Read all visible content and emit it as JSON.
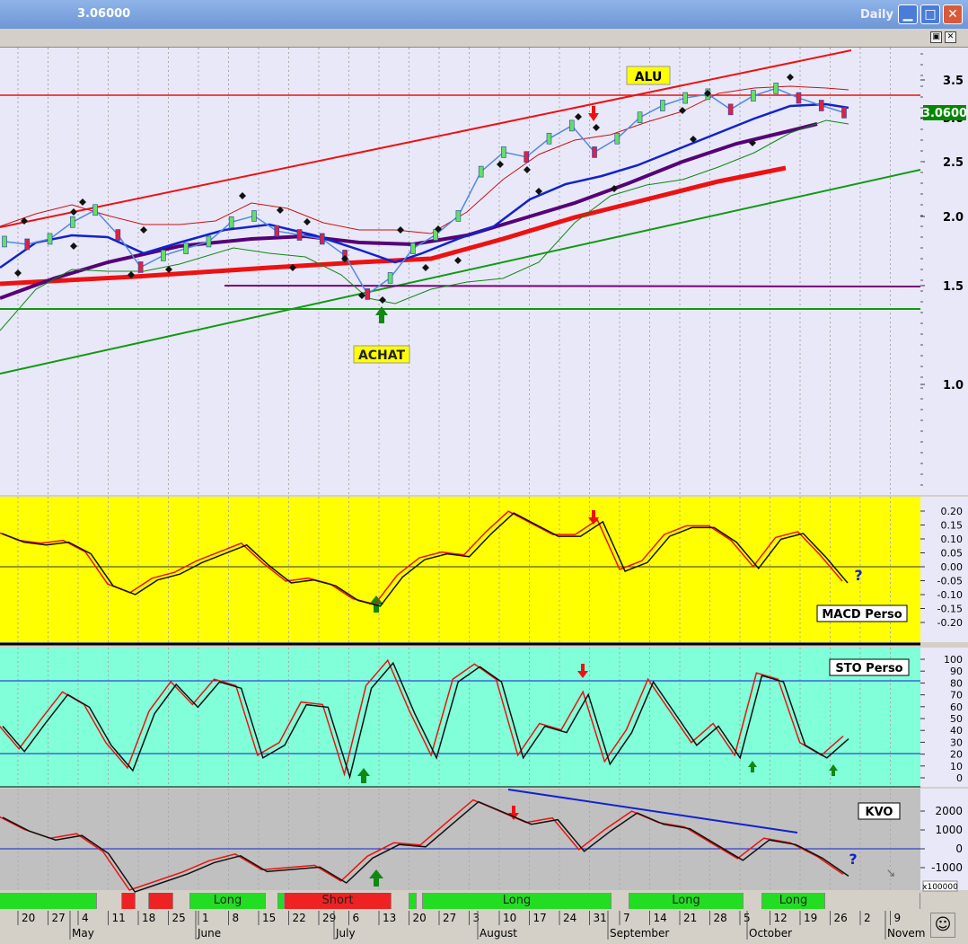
{
  "window": {
    "title": "3.06000",
    "period": "Daily"
  },
  "price_panel": {
    "last_price": "3.0600",
    "labels": {
      "top": "ALU",
      "bottom": "ACHAT"
    },
    "yticks": [
      "3.5",
      "3.0",
      "2.5",
      "2.0",
      "1.5",
      "1.0"
    ]
  },
  "macd_panel": {
    "name": "MACD Perso",
    "yticks": [
      "0.20",
      "0.15",
      "0.10",
      "0.05",
      "0.00",
      "-0.05",
      "-0.10",
      "-0.15",
      "-0.20"
    ],
    "question": "?"
  },
  "sto_panel": {
    "name": "STO Perso",
    "yticks": [
      "100",
      "90",
      "80",
      "70",
      "60",
      "50",
      "40",
      "30",
      "20",
      "10",
      "0"
    ]
  },
  "kvo_panel": {
    "name": "KVO",
    "yticks": [
      "2000",
      "1000",
      "0",
      "-1000"
    ],
    "multiplier": "x100000",
    "question": "?"
  },
  "signals": [
    {
      "label": "",
      "state": "long"
    },
    {
      "label": "",
      "state": "short"
    },
    {
      "label": "",
      "state": "short"
    },
    {
      "label": "Long",
      "state": "long"
    },
    {
      "label": "",
      "state": "long"
    },
    {
      "label": "Short",
      "state": "short"
    },
    {
      "label": "",
      "state": "long"
    },
    {
      "label": "Long",
      "state": "long"
    },
    {
      "label": "Long",
      "state": "long"
    },
    {
      "label": "Long",
      "state": "long"
    }
  ],
  "x_axis": {
    "days": [
      "20",
      "27",
      "4",
      "11",
      "18",
      "25",
      "1",
      "8",
      "15",
      "22",
      "29",
      "6",
      "13",
      "20",
      "27",
      "3",
      "10",
      "17",
      "24",
      "31",
      "7",
      "14",
      "21",
      "28",
      "5",
      "12",
      "19",
      "26",
      "2",
      "9"
    ],
    "months": [
      "May",
      "June",
      "July",
      "August",
      "September",
      "October",
      "Novem"
    ]
  },
  "colors": {
    "long": "#22dd22",
    "short": "#ee2222",
    "macd_bg": "#ffff00",
    "sto_bg": "#80ffd8",
    "kvo_bg": "#c0c0c0",
    "price_bg": "#e8e8f8"
  },
  "chart_data": [
    {
      "type": "line",
      "title": "",
      "series": [
        {
          "values": [
            1.8,
            1.78,
            1.82,
            1.95,
            2.05,
            1.85,
            1.62,
            1.7,
            1.75,
            1.8,
            1.95,
            2.0,
            1.88,
            1.85,
            1.82,
            1.7,
            1.45,
            1.55,
            1.75,
            1.85,
            2.0,
            2.4,
            2.6,
            2.55,
            2.75,
            2.9,
            2.6,
            2.75,
            3.0,
            3.15,
            3.25,
            3.3,
            3.1,
            3.28,
            3.38,
            3.25,
            3.15,
            3.06
          ]
        }
      ],
      "ylim": [
        0.8,
        3.8
      ]
    },
    {
      "type": "line",
      "title": "MACD Perso",
      "series": [
        {
          "values": [
            0.13,
            0.1,
            0.09,
            0.1,
            0.06,
            -0.05,
            -0.08,
            -0.03,
            -0.01,
            0.03,
            0.06,
            0.09,
            0.02,
            -0.04,
            -0.03,
            -0.05,
            -0.1,
            -0.12,
            -0.02,
            0.04,
            0.06,
            0.05,
            0.13,
            0.2,
            0.16,
            0.12,
            0.12,
            0.17,
            0.0,
            0.03,
            0.12,
            0.15,
            0.15,
            0.1,
            0.01,
            0.11,
            0.13,
            0.05,
            -0.04
          ]
        }
      ],
      "ylim": [
        -0.25,
        0.25
      ]
    },
    {
      "type": "line",
      "title": "STO Perso",
      "series": [
        {
          "values": [
            45,
            25,
            48,
            70,
            60,
            30,
            10,
            55,
            78,
            60,
            80,
            75,
            20,
            30,
            62,
            60,
            5,
            75,
            95,
            55,
            20,
            80,
            92,
            80,
            20,
            45,
            40,
            70,
            15,
            40,
            80,
            55,
            30,
            45,
            20,
            85,
            80,
            30,
            20,
            35
          ]
        }
      ],
      "ylim": [
        -5,
        105
      ]
    },
    {
      "type": "line",
      "title": "KVO",
      "series": [
        {
          "values": [
            1800,
            1200,
            800,
            1000,
            200,
            -1500,
            -1100,
            -700,
            -200,
            100,
            -600,
            -500,
            -400,
            -1100,
            0,
            600,
            500,
            1500,
            2500,
            2000,
            1500,
            1700,
            300,
            1200,
            2000,
            1500,
            1300,
            600,
            -100,
            800,
            600,
            0,
            -800
          ]
        }
      ],
      "ylim": [
        -1500,
        3000
      ]
    }
  ]
}
